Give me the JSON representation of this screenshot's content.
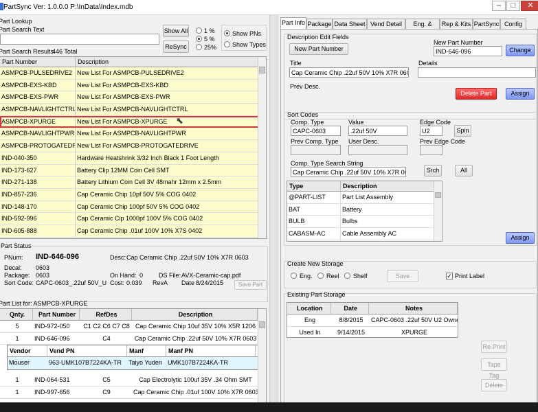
{
  "window": {
    "title": "PartSync Ver: 1.0.0.0  P:\\InData\\Index.mdb",
    "min": "–",
    "max": "□",
    "close": "✕"
  },
  "left": {
    "lookup": {
      "title": "Part Lookup",
      "search_label": "Part Search Text",
      "search_value": "",
      "show_all": "Show All",
      "resync": "ReSync",
      "pct": [
        "1 %",
        "5 %",
        "25%"
      ],
      "pct_selected": 1,
      "show_pns": "Show PNs",
      "show_types": "Show Types",
      "show_selected": "Show PNs"
    },
    "results": {
      "label": "Part Search Results",
      "count": "446 Total",
      "col_pn": "Part Number",
      "col_desc": "Description",
      "rows": [
        {
          "pn": "ASMPCB-PULSEDRIVE2",
          "desc": "New List For ASMPCB-PULSEDRIVE2"
        },
        {
          "pn": "ASMPCB-EXS-KBD",
          "desc": "New List For ASMPCB-EXS-KBD"
        },
        {
          "pn": "ASMPCB-EXS-PWR",
          "desc": "New List For ASMPCB-EXS-PWR"
        },
        {
          "pn": "ASMPCB-NAVLIGHTCTRL",
          "desc": "New List For ASMPCB-NAVLIGHTCTRL"
        },
        {
          "pn": "ASMPCB-XPURGE",
          "desc": "New List For ASMPCB-XPURGE"
        },
        {
          "pn": "ASMPCB-NAVLIGHTPWR",
          "desc": "New List For ASMPCB-NAVLIGHTPWR"
        },
        {
          "pn": "ASMPCB-PROTOGATEDRIV",
          "desc": "New List For ASMPCB-PROTOGATEDRIVE"
        },
        {
          "pn": "IND-040-350",
          "desc": "Hardware Heatshrink 3/32 Inch Black 1 Foot Length"
        },
        {
          "pn": "IND-173-627",
          "desc": "Battery Clip 12MM Coin Cell SMT"
        },
        {
          "pn": "IND-271-138",
          "desc": "Battery Lithium Coin Cell 3V 48mahr 12mm x 2.5mm"
        },
        {
          "pn": "IND-857-236",
          "desc": "Cap Ceramic Chip 10pf 50V 5% COG 0402"
        },
        {
          "pn": "IND-148-170",
          "desc": "Cap Ceramic Chip 100pf 50V 5% COG 0402"
        },
        {
          "pn": "IND-592-996",
          "desc": "Cap Ceramic Cip 1000pf 100V 5% COG 0402"
        },
        {
          "pn": "IND-605-888",
          "desc": "Cap Ceramic Chip .01uf 100V 10% X7S 0402"
        }
      ]
    },
    "status": {
      "title": "Part Status",
      "pnum_label": "PNum:",
      "pnum": "IND-646-096",
      "desc_label": "Desc:",
      "desc": "Cap Ceramic Chip .22uf 50V 10% X7R 0603",
      "decal_label": "Decal:",
      "decal": "0603",
      "package_label": "Package:",
      "package": "0603",
      "sort_label": "Sort Code:",
      "sort": "CAPC-0603_.22uf 50V_U",
      "onhand_label": "On Hand:",
      "onhand": "0",
      "cost_label": "Cost:",
      "cost": "0.039",
      "ds_label": "DS File:",
      "ds": "AVX-Ceramic-cap.pdf",
      "rev_label": "Rev",
      "rev": "A",
      "date_label": "Date",
      "date": "8/24/2015",
      "save": "Save Part"
    },
    "parts": {
      "title": "Part List for: ASMPCB-XPURGE",
      "cols": [
        "Qnty.",
        "Part Number",
        "RefDes",
        "Description"
      ],
      "rows": [
        {
          "q": "5",
          "pn": "IND-972-050",
          "ref": "C1 C2 C6 C7 C8",
          "desc": "Cap Ceramic Chip 10uf 35V 10% X5R 1206"
        },
        {
          "q": "1",
          "pn": "IND-646-096",
          "ref": "C4",
          "desc": "Cap Ceramic Chip .22uf 50V 10% X7R 0603"
        }
      ],
      "vcols": [
        "Vendor",
        "Vend PN",
        "Manf",
        "Manf PN"
      ],
      "vrow": {
        "v": "Mouser",
        "vpn": "963-UMK107B7224KA-TR",
        "m": "Taiyo Yuden",
        "mpn": "UMK107B7224KA-TR"
      },
      "rows2": [
        {
          "q": "1",
          "pn": "IND-064-531",
          "ref": "C5",
          "desc": "Cap Electrolytic 100uf 35V .34 Ohm SMT"
        },
        {
          "q": "1",
          "pn": "IND-997-656",
          "ref": "C9",
          "desc": "Cap Ceramic Chip .01uf 100V 10% X7R 0603"
        }
      ]
    }
  },
  "right": {
    "tabs": [
      "Part Info",
      "Package",
      "Data Sheet",
      "Vend Detail",
      "Eng. & CAD",
      "Rep & Kits",
      "PartSync",
      "Config"
    ],
    "edit": {
      "title": "Description Edit Fields",
      "new_btn": "New Part Number",
      "npn_label": "New Part Number",
      "npn": "IND-646-096",
      "change": "Change",
      "title_label": "Title",
      "title_val": "Cap Ceramic Chip .22uf 50V 10% X7R 0603",
      "details_label": "Details",
      "details_val": "",
      "prev_label": "Prev Desc.",
      "delete": "Delete Part",
      "assign": "Assign"
    },
    "sort": {
      "title": "Sort Codes",
      "ct_label": "Comp. Type",
      "ct": "CAPC-0603",
      "val_label": "Value",
      "val": ".22uf 50V",
      "edge_label": "Edge Code",
      "edge": "U2",
      "spin": "Spin",
      "pct_label": "Prev Comp. Type",
      "user_label": "User Desc.",
      "pedge_label": "Prev Edge Code",
      "search_label": "Comp. Type Search String",
      "search": "Cap Ceramic Chip .22uf 50V 10% X7R 060",
      "srch": "Srch",
      "all": "All",
      "cols": [
        "Type",
        "Description"
      ],
      "rows": [
        {
          "t": "@PART-LIST",
          "d": "Part List Assembly"
        },
        {
          "t": "BAT",
          "d": "Battery"
        },
        {
          "t": "BULB",
          "d": "Bulbs"
        },
        {
          "t": "CABASM-AC",
          "d": "Cable Assembly AC"
        },
        {
          "t": "CABASM-CUST",
          "d": "Cable Assembly Custom"
        }
      ],
      "assign": "Assign"
    },
    "storage": {
      "title": "Create New Storage",
      "opts": [
        "Eng.",
        "Reel",
        "Shelf"
      ],
      "save": "Save",
      "print": "Print Label",
      "print_checked": "✓"
    },
    "existing": {
      "title": "Existing Part Storage",
      "cols": [
        "Location",
        "Date",
        "Notes"
      ],
      "rows": [
        {
          "l": "Eng",
          "d": "8/8/2015",
          "n": "CAPC-0603 .22uf 50V U2 Owner"
        },
        {
          "l": "Used In",
          "d": "9/14/2015",
          "n": "XPURGE"
        }
      ],
      "reprint": "Re-Print",
      "tapetag": "Tape Tag",
      "delete": "Delete"
    }
  }
}
